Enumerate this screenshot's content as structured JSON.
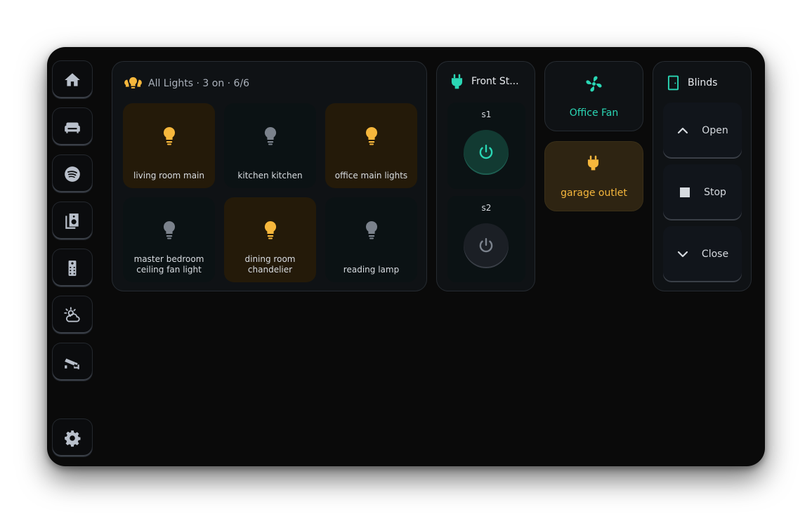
{
  "sidebar": {
    "items": [
      {
        "name": "home-icon"
      },
      {
        "name": "sofa-icon"
      },
      {
        "name": "spotify-icon"
      },
      {
        "name": "speaker-icon"
      },
      {
        "name": "remote-icon"
      },
      {
        "name": "weather-icon"
      },
      {
        "name": "camera-icon"
      }
    ],
    "settings": {
      "name": "gear-icon"
    }
  },
  "lights": {
    "title": "All Lights · 3 on · 6/6",
    "tiles": [
      {
        "label": "living room main",
        "state": "on"
      },
      {
        "label": "kitchen kitchen",
        "state": "off"
      },
      {
        "label": "office main lights",
        "state": "on"
      },
      {
        "label": "master bedroom ceiling fan light",
        "state": "off"
      },
      {
        "label": "dining room chandelier",
        "state": "on"
      },
      {
        "label": "reading lamp",
        "state": "off"
      }
    ]
  },
  "front": {
    "title": "Front St...",
    "switches": [
      {
        "label": "s1",
        "state": "on"
      },
      {
        "label": "s2",
        "state": "off"
      }
    ]
  },
  "fan": {
    "label": "Office Fan"
  },
  "outlet": {
    "label": "garage outlet"
  },
  "blinds": {
    "title": "Blinds",
    "buttons": {
      "open": "Open",
      "stop": "Stop",
      "close": "Close"
    }
  },
  "colors": {
    "accent_teal": "#2ad6b4",
    "light_on": "#f6b73c",
    "light_off": "#7b828c"
  }
}
